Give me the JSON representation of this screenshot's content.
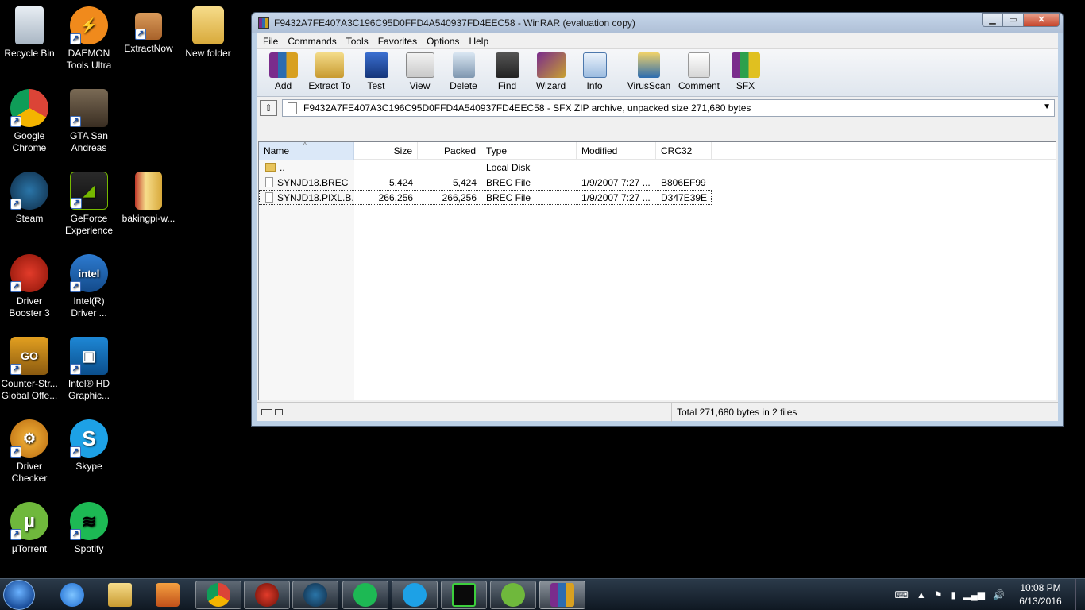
{
  "desktop": {
    "icons": [
      {
        "label": "Recycle Bin"
      },
      {
        "label": "DAEMON Tools Ultra"
      },
      {
        "label": "ExtractNow"
      },
      {
        "label": "New folder"
      },
      {
        "label": "Google Chrome"
      },
      {
        "label": "GTA San Andreas"
      },
      {
        "label": "Steam"
      },
      {
        "label": "GeForce Experience"
      },
      {
        "label": "bakingpi-w..."
      },
      {
        "label": "Driver Booster 3"
      },
      {
        "label": "Intel(R) Driver ..."
      },
      {
        "label": "Counter-Str... Global Offe..."
      },
      {
        "label": "Intel® HD Graphic..."
      },
      {
        "label": "Driver Checker"
      },
      {
        "label": "Skype"
      },
      {
        "label": "µTorrent"
      },
      {
        "label": "Spotify"
      }
    ]
  },
  "window": {
    "title": "F9432A7FE407A3C196C95D0FFD4A540937FD4EEC58 - WinRAR (evaluation copy)",
    "min_glyph": "▁",
    "max_glyph": "▭",
    "close_glyph": "✕",
    "menu": [
      "File",
      "Commands",
      "Tools",
      "Favorites",
      "Options",
      "Help"
    ],
    "toolbar": [
      "Add",
      "Extract To",
      "Test",
      "View",
      "Delete",
      "Find",
      "Wizard",
      "Info",
      "VirusScan",
      "Comment",
      "SFX"
    ],
    "address": "F9432A7FE407A3C196C95D0FFD4A540937FD4EEC58 - SFX ZIP archive, unpacked size 271,680 bytes",
    "up_glyph": "⇧",
    "dropdown_glyph": "▼",
    "columns": [
      "Name",
      "Size",
      "Packed",
      "Type",
      "Modified",
      "CRC32"
    ],
    "sort_glyph": "^",
    "rows": [
      {
        "name": "..",
        "size": "",
        "packed": "",
        "type": "Local Disk",
        "modified": "",
        "crc": ""
      },
      {
        "name": "SYNJD18.BREC",
        "size": "5,424",
        "packed": "5,424",
        "type": "BREC File",
        "modified": "1/9/2007 7:27 ...",
        "crc": "B806EF99"
      },
      {
        "name": "SYNJD18.PIXL.B...",
        "size": "266,256",
        "packed": "266,256",
        "type": "BREC File",
        "modified": "1/9/2007 7:27 ...",
        "crc": "D347E39E"
      }
    ],
    "status": "Total 271,680 bytes in 2 files"
  },
  "taskbar": {
    "time": "10:08 PM",
    "date": "6/13/2016"
  },
  "colors": {
    "desktop_bg": "#000000",
    "window_frame": "#bcd0e6",
    "taskbar": "#1b2733"
  }
}
